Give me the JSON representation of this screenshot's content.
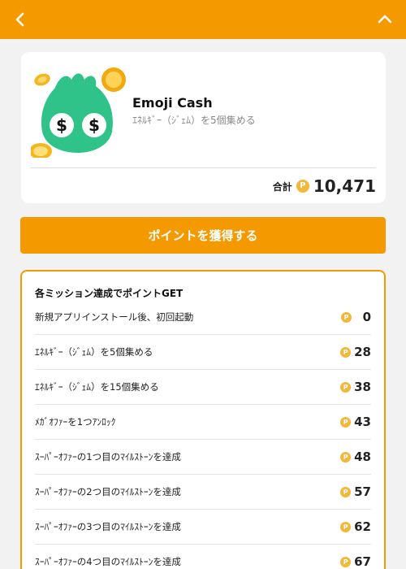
{
  "colors": {
    "accent": "#f49a00",
    "coin": "#f2b83a",
    "icon_green": "#2fc389"
  },
  "header": {
    "back_icon": "chevron-left-icon",
    "collapse_icon": "chevron-up-icon"
  },
  "app": {
    "icon": "emoji-cash-app-icon",
    "name": "Emoji Cash",
    "subtitle": "ｴﾈﾙｷﾞｰ（ｼﾞｪﾑ）を5個集める",
    "total_label": "合計",
    "coin_symbol": "P",
    "total_points": "10,471"
  },
  "cta": {
    "label": "ポイントを獲得する"
  },
  "missions": {
    "title": "各ミッション達成でポイントGET",
    "coin_symbol": "P",
    "items": [
      {
        "label": "新規アプリインストール後、初回起動",
        "points": "0"
      },
      {
        "label": "ｴﾈﾙｷﾞｰ（ｼﾞｪﾑ）を5個集める",
        "points": "28"
      },
      {
        "label": "ｴﾈﾙｷﾞｰ（ｼﾞｪﾑ）を15個集める",
        "points": "38"
      },
      {
        "label": "ﾒｶﾞｵﾌｧｰを1つｱﾝﾛｯｸ",
        "points": "43"
      },
      {
        "label": "ｽｰﾊﾟｰｵﾌｧｰの1つ目のﾏｲﾙｽﾄｰﾝを達成",
        "points": "48"
      },
      {
        "label": "ｽｰﾊﾟｰｵﾌｧｰの2つ目のﾏｲﾙｽﾄｰﾝを達成",
        "points": "57"
      },
      {
        "label": "ｽｰﾊﾟｰｵﾌｧｰの3つ目のﾏｲﾙｽﾄｰﾝを達成",
        "points": "62"
      },
      {
        "label": "ｽｰﾊﾟｰｵﾌｧｰの4つ目のﾏｲﾙｽﾄｰﾝを達成",
        "points": "67"
      }
    ]
  }
}
